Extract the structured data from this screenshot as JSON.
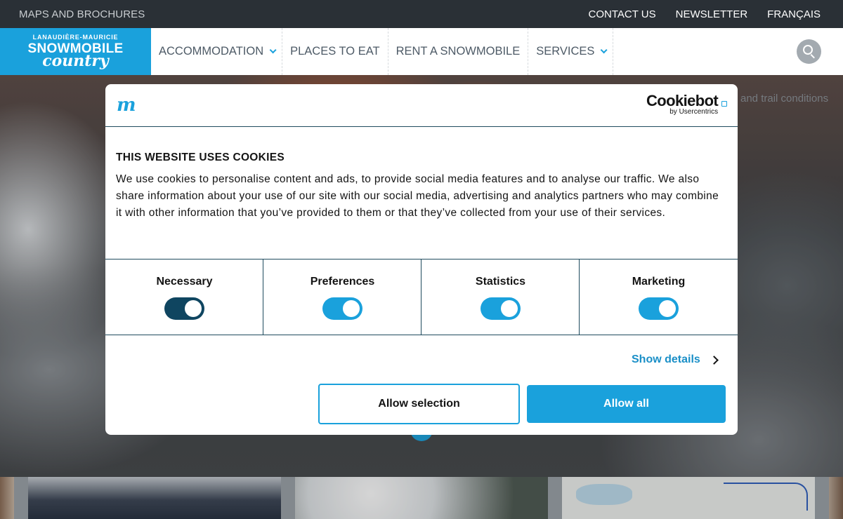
{
  "topbar": {
    "left_link": "MAPS AND BROCHURES",
    "right_links": [
      "CONTACT US",
      "NEWSLETTER",
      "FRANÇAIS"
    ]
  },
  "logo": {
    "line1": "LANAUDIÈRE-MAURICIE",
    "line2": "SNOWMOBILE",
    "line3": "country"
  },
  "nav": {
    "items": [
      {
        "label": "ACCOMMODATION",
        "has_dropdown": true
      },
      {
        "label": "PLACES TO EAT",
        "has_dropdown": false
      },
      {
        "label": "RENT A SNOWMOBILE",
        "has_dropdown": false
      },
      {
        "label": "SERVICES",
        "has_dropdown": true
      }
    ],
    "search_icon": "search-icon"
  },
  "hero": {
    "trail_text": "and trail conditions"
  },
  "cookie_dialog": {
    "site_logo_letter": "m",
    "brand_name": "Cookiebot",
    "brand_by": "by Usercentrics",
    "title": "THIS WEBSITE USES COOKIES",
    "body": "We use cookies to personalise content and ads, to provide social media features and to analyse our traffic. We also share information about your use of our site with our social media, advertising and analytics partners who may combine it with other information that you’ve provided to them or that they’ve collected from your use of their services.",
    "toggles": [
      {
        "label": "Necessary",
        "on": true,
        "locked": true
      },
      {
        "label": "Preferences",
        "on": true,
        "locked": false
      },
      {
        "label": "Statistics",
        "on": true,
        "locked": false
      },
      {
        "label": "Marketing",
        "on": true,
        "locked": false
      }
    ],
    "show_details": "Show details",
    "allow_selection": "Allow selection",
    "allow_all": "Allow all"
  },
  "colors": {
    "accent": "#1aa1dc",
    "dark_toggle": "#0f4560",
    "topbar": "#2a3036",
    "divider": "#1f4b5e"
  }
}
